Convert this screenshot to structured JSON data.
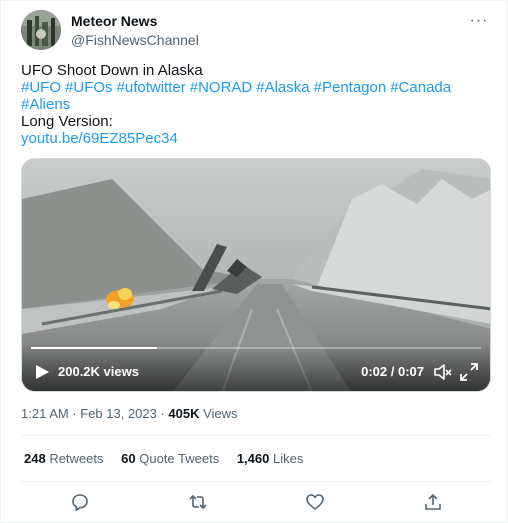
{
  "author": {
    "display_name": "Meteor News",
    "handle": "@FishNewsChannel",
    "avatar_icon": "avatar-photo-icon"
  },
  "menu_icon": "more-dots-icon",
  "menu_glyph": "···",
  "tweet": {
    "line1": "UFO Shoot Down in Alaska",
    "hashtags": [
      "#UFO",
      "#UFOs",
      "#ufotwitter",
      "#NORAD",
      "#Alaska",
      "#Pentagon",
      "#Canada",
      "#Aliens"
    ],
    "line_long": "Long Version:",
    "link": "youtu.be/69EZ85Pec34"
  },
  "video": {
    "views": "200.2K views",
    "time": "0:02 / 0:07",
    "progress": 0.28,
    "play_icon": "play-icon",
    "mute_icon": "mute-icon",
    "fullscreen_icon": "fullscreen-icon"
  },
  "meta": {
    "timestamp": "1:21 AM · Feb 13, 2023 · ",
    "views_count": "405K",
    "views_label": " Views"
  },
  "stats": {
    "retweets_count": "248",
    "retweets_label": " Retweets",
    "quotes_count": "60",
    "quotes_label": " Quote Tweets",
    "likes_count": "1,460",
    "likes_label": " Likes"
  },
  "actions": {
    "reply_icon": "reply-icon",
    "retweet_icon": "retweet-icon",
    "like_icon": "like-icon",
    "share_icon": "share-icon"
  },
  "colors": {
    "accent": "#1d9bf0",
    "text": "#0f1419",
    "secondary": "#536471",
    "border": "#eff3f4"
  }
}
